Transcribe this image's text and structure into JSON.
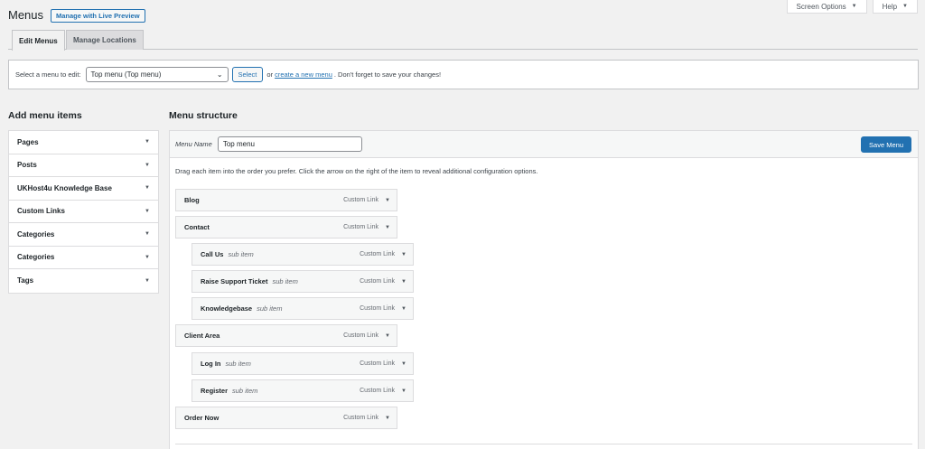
{
  "screen_meta": {
    "screen_options": "Screen Options",
    "help": "Help"
  },
  "page": {
    "title": "Menus",
    "live_preview": "Manage with Live Preview"
  },
  "tabs": [
    {
      "label": "Edit Menus",
      "active": true
    },
    {
      "label": "Manage Locations",
      "active": false
    }
  ],
  "manage": {
    "label": "Select a menu to edit:",
    "selected": "Top menu (Top menu)",
    "select_button": "Select",
    "or_text": "or",
    "create_link": "create a new menu",
    "suffix": ". Don't forget to save your changes!"
  },
  "add_items": {
    "heading": "Add menu items",
    "sections": [
      "Pages",
      "Posts",
      "UKHost4u Knowledge Base",
      "Custom Links",
      "Categories",
      "Categories",
      "Tags"
    ]
  },
  "structure": {
    "heading": "Menu structure",
    "name_label": "Menu Name",
    "name_value": "Top menu",
    "save_button": "Save Menu",
    "instructions": "Drag each item into the order you prefer. Click the arrow on the right of the item to reveal additional configuration options.",
    "items": [
      {
        "title": "Blog",
        "sub": "",
        "type": "Custom Link",
        "depth": 0
      },
      {
        "title": "Contact",
        "sub": "",
        "type": "Custom Link",
        "depth": 0
      },
      {
        "title": "Call Us",
        "sub": "sub item",
        "type": "Custom Link",
        "depth": 1
      },
      {
        "title": "Raise Support Ticket",
        "sub": "sub item",
        "type": "Custom Link",
        "depth": 1
      },
      {
        "title": "Knowledgebase",
        "sub": "sub item",
        "type": "Custom Link",
        "depth": 1
      },
      {
        "title": "Client Area",
        "sub": "",
        "type": "Custom Link",
        "depth": 0
      },
      {
        "title": "Log In",
        "sub": "sub item",
        "type": "Custom Link",
        "depth": 1
      },
      {
        "title": "Register",
        "sub": "sub item",
        "type": "Custom Link",
        "depth": 1
      },
      {
        "title": "Order Now",
        "sub": "",
        "type": "Custom Link",
        "depth": 0
      }
    ]
  }
}
